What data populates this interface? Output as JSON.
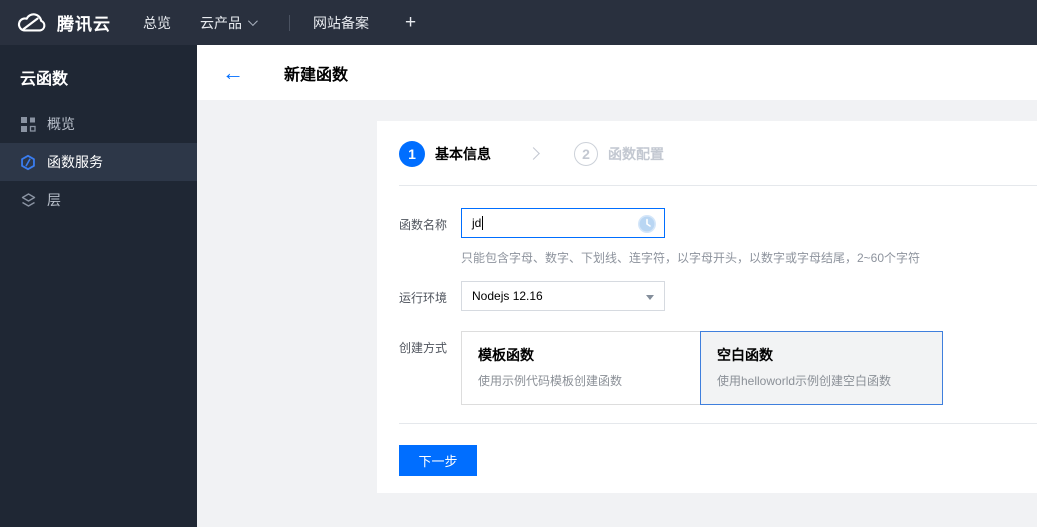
{
  "navbar": {
    "brand": "腾讯云",
    "items": [
      {
        "label": "总览"
      },
      {
        "label": "云产品"
      },
      {
        "label": "网站备案"
      }
    ],
    "plus_label": "+"
  },
  "sidebar": {
    "title": "云函数",
    "items": [
      {
        "label": "概览",
        "icon": "grid-icon",
        "selected": false
      },
      {
        "label": "函数服务",
        "icon": "function-service-icon",
        "selected": true
      },
      {
        "label": "层",
        "icon": "layers-icon",
        "selected": false
      }
    ]
  },
  "header": {
    "back_glyph": "←",
    "title": "新建函数"
  },
  "wizard": {
    "steps": [
      {
        "number": "1",
        "label": "基本信息",
        "active": true
      },
      {
        "number": "2",
        "label": "函数配置",
        "active": false
      }
    ]
  },
  "form": {
    "name": {
      "label": "函数名称",
      "value": "jd",
      "hint": "只能包含字母、数字、下划线、连字符，以字母开头，以数字或字母结尾，2~60个字符",
      "status_icon": "clock-icon"
    },
    "runtime": {
      "label": "运行环境",
      "value": "Nodejs 12.16"
    },
    "method": {
      "label": "创建方式",
      "options": [
        {
          "title": "模板函数",
          "desc": "使用示例代码模板创建函数",
          "selected": false
        },
        {
          "title": "空白函数",
          "desc": "使用helloworld示例创建空白函数",
          "selected": true
        }
      ]
    }
  },
  "actions": {
    "next_label": "下一步"
  },
  "colors": {
    "accent": "#006eff",
    "navbar_bg": "#29303e",
    "sidebar_bg": "#1f2734",
    "sidebar_selected_bg": "#2d3748",
    "content_bg": "#f1f2f4",
    "divider": "#e5e8ec",
    "step_inactive": "#c3c8d1",
    "card_selected_border": "#3f7fdd",
    "card_selected_bg": "#f2f3f4"
  }
}
